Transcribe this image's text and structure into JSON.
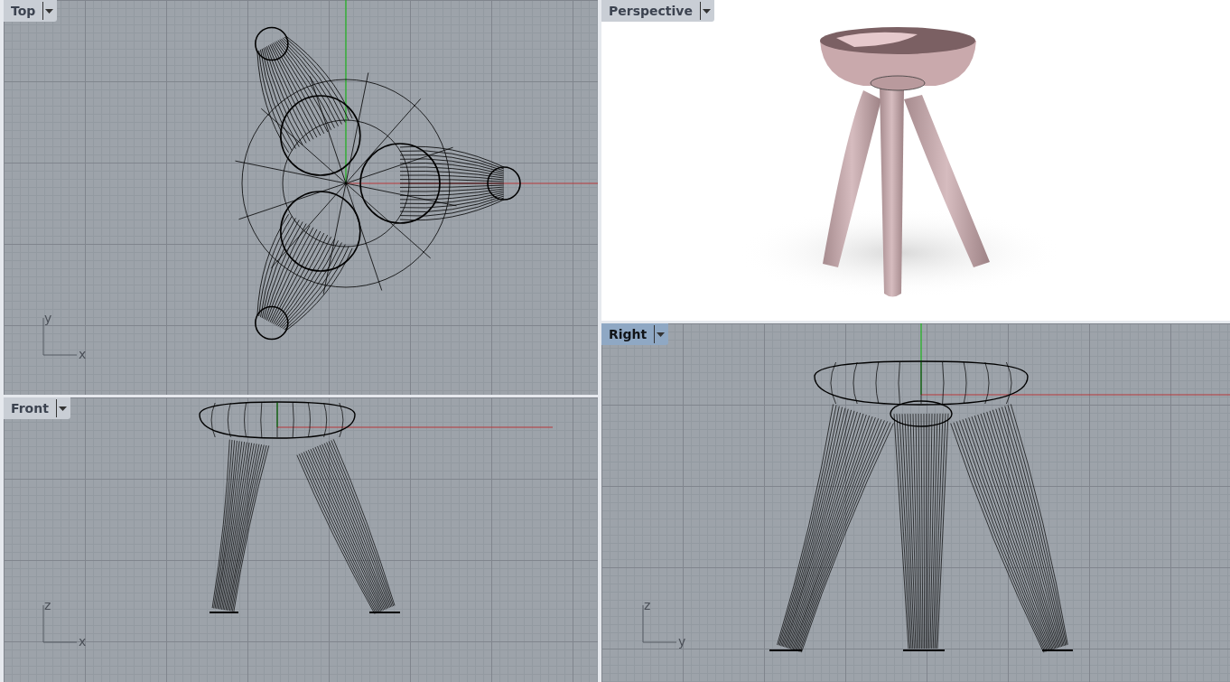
{
  "viewports": [
    {
      "kind": "top",
      "label": "Top",
      "selected": false,
      "axes": [
        "x",
        "y"
      ]
    },
    {
      "kind": "front",
      "label": "Front",
      "selected": false,
      "axes": [
        "x",
        "z"
      ]
    },
    {
      "kind": "perspective",
      "label": "Perspective",
      "selected": false
    },
    {
      "kind": "right",
      "label": "Right",
      "selected": true,
      "axes": [
        "y",
        "z"
      ]
    }
  ]
}
